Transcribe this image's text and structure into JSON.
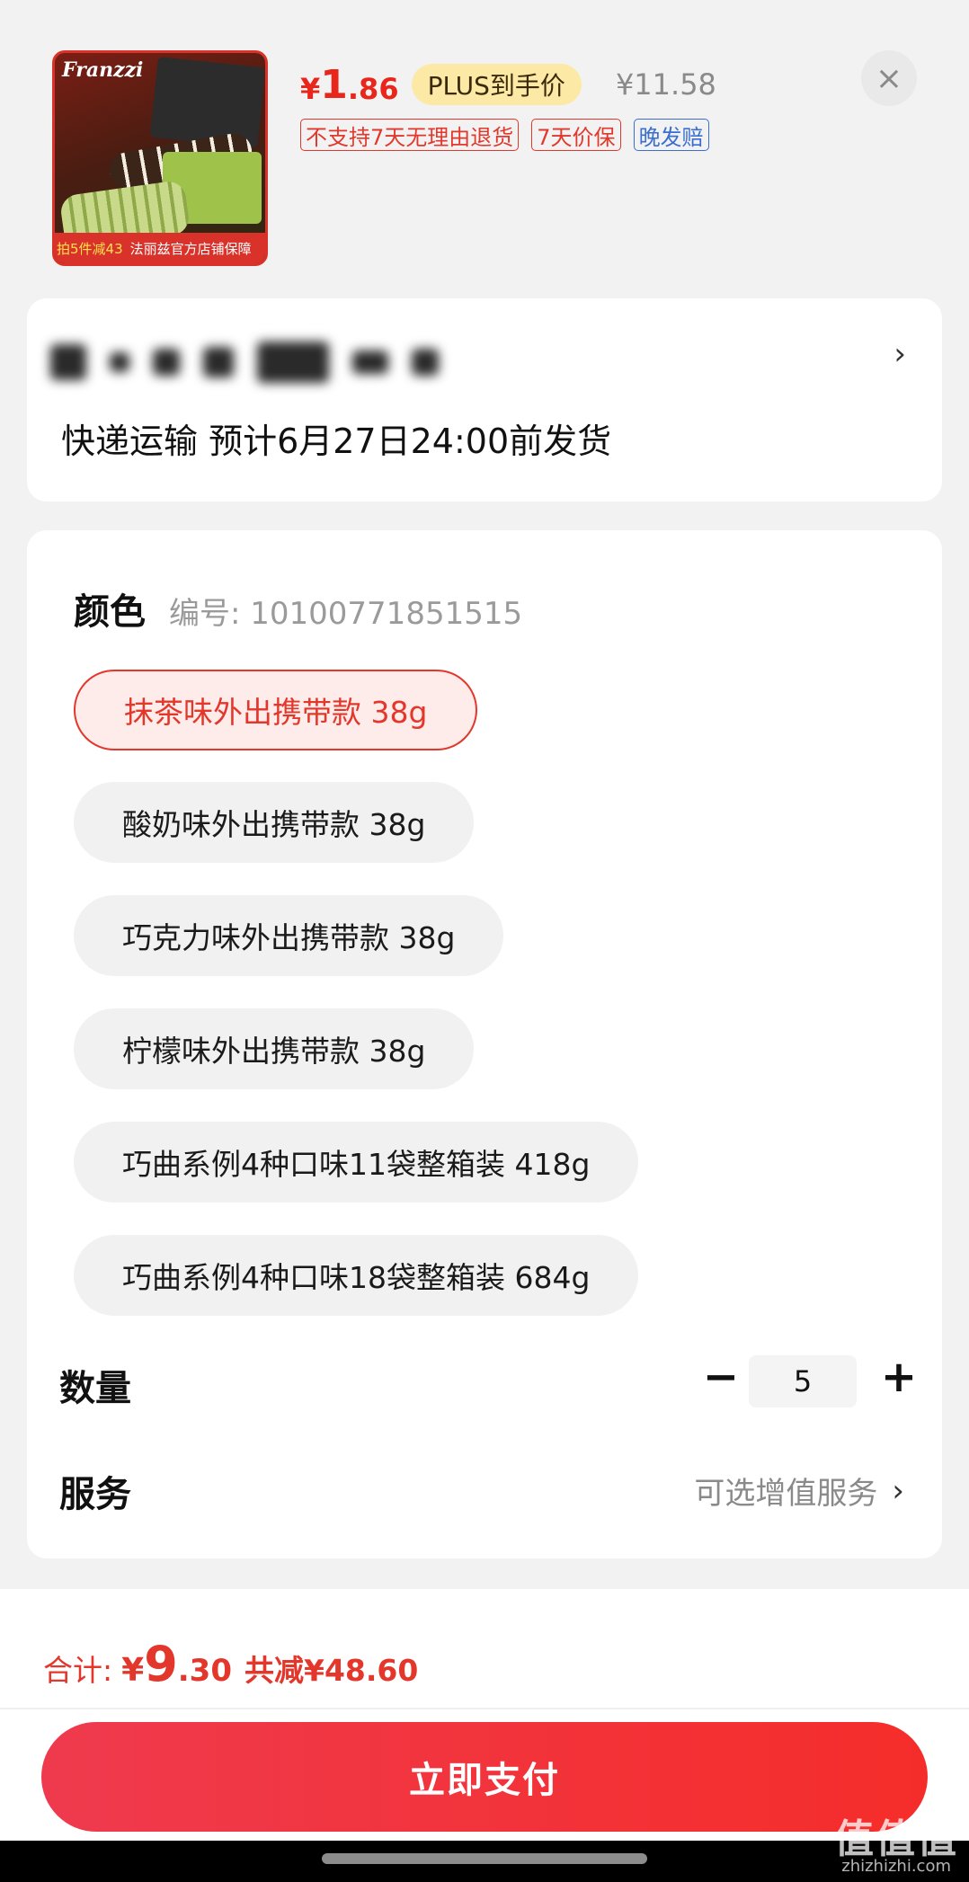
{
  "product": {
    "thumb_brand": "Franzzi",
    "thumb_promo": "拍5件减43",
    "thumb_store": "法丽兹官方店铺保障",
    "price_yen": "¥",
    "price_int": "1",
    "price_dec": ".86",
    "plus_label": "PLUS到手价",
    "original_price": "¥11.58",
    "tags": [
      "不支持7天无理由退货",
      "7天价保",
      "晚发赔"
    ]
  },
  "address": {
    "shipping": "快递运输 预计6月27日24:00前发货",
    "arrow": "›"
  },
  "spec": {
    "title": "颜色",
    "sku": "编号: 10100771851515",
    "options": [
      "抹茶味外出携带款 38g",
      "酸奶味外出携带款 38g",
      "巧克力味外出携带款 38g",
      "柠檬味外出携带款 38g",
      "巧曲系例4种口味11袋整箱装 418g",
      "巧曲系例4种口味18袋整箱装 684g"
    ],
    "selected_option": "抹茶味外出携带款 38g"
  },
  "quantity": {
    "label": "数量",
    "minus": "−",
    "value": "5",
    "plus": "+"
  },
  "service": {
    "label": "服务",
    "value": "可选增值服务",
    "arrow": "›"
  },
  "total": {
    "label": "合计:",
    "yen": "¥",
    "int": "9",
    "dec": ".30",
    "save": "共减¥48.60"
  },
  "pay_button": "立即支付",
  "close_symbol": "×",
  "watermark": {
    "main": "值值值",
    "sub": "zhizhizhi.com"
  },
  "colors": {
    "accent": "#e3372c",
    "pay_gradient_start": "#ef3a4e",
    "pay_gradient_end": "#f52d2a",
    "plus_badge": "#fde9a6"
  }
}
